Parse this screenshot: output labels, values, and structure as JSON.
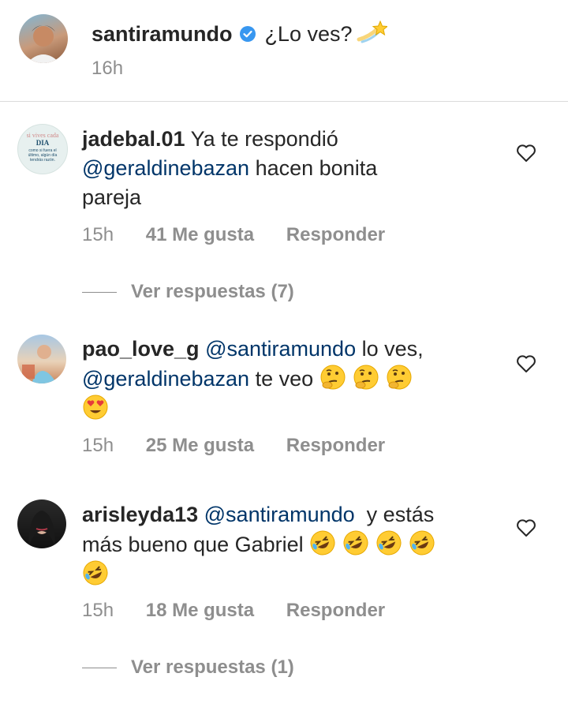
{
  "post": {
    "username": "santiramundo",
    "caption": "¿Lo ves?",
    "time": "16h",
    "verified_icon": "verified-badge-icon",
    "caption_emoji": "shooting-star-emoji"
  },
  "comments": [
    {
      "username": "jadebal.01",
      "text_before": "Ya te respondió",
      "mention": "@geraldinebazan",
      "text_after": "hacen bonita pareja",
      "line2_mention": "@geraldinebazan",
      "line2_text": "hacen bonita",
      "line3_text": "pareja",
      "time": "15h",
      "likes": "41 Me gusta",
      "reply_label": "Responder",
      "view_replies": "Ver respuestas (7)",
      "avatar_text": {
        "l1": "si vives cada",
        "l2": "DIA",
        "l3": "como si fuera el",
        "l4": "último, algún día",
        "l5": "tendrás razón."
      }
    },
    {
      "username": "pao_love_g",
      "mention1": "@santiramundo",
      "text1": "lo ves,",
      "mention2": "@geraldinebazan",
      "text2": "te veo",
      "emojis": [
        "thinking-face-emoji",
        "thinking-face-emoji",
        "thinking-face-emoji",
        "heart-eyes-emoji"
      ],
      "time": "15h",
      "likes": "25 Me gusta",
      "reply_label": "Responder"
    },
    {
      "username": "arisleyda13",
      "mention": "@santiramundo",
      "text1": "y estás",
      "text2": "más bueno que Gabriel",
      "emojis": [
        "rofl-emoji",
        "rofl-emoji",
        "rofl-emoji",
        "rofl-emoji",
        "rofl-emoji"
      ],
      "time": "15h",
      "likes": "18 Me gusta",
      "reply_label": "Responder",
      "view_replies": "Ver respuestas (1)"
    }
  ],
  "icons": {
    "like": "heart-outline-icon"
  },
  "colors": {
    "text": "#262626",
    "secondary": "#8e8e8e",
    "mention": "#003569",
    "verified": "#3897f0",
    "divider": "#dbdbdb"
  }
}
